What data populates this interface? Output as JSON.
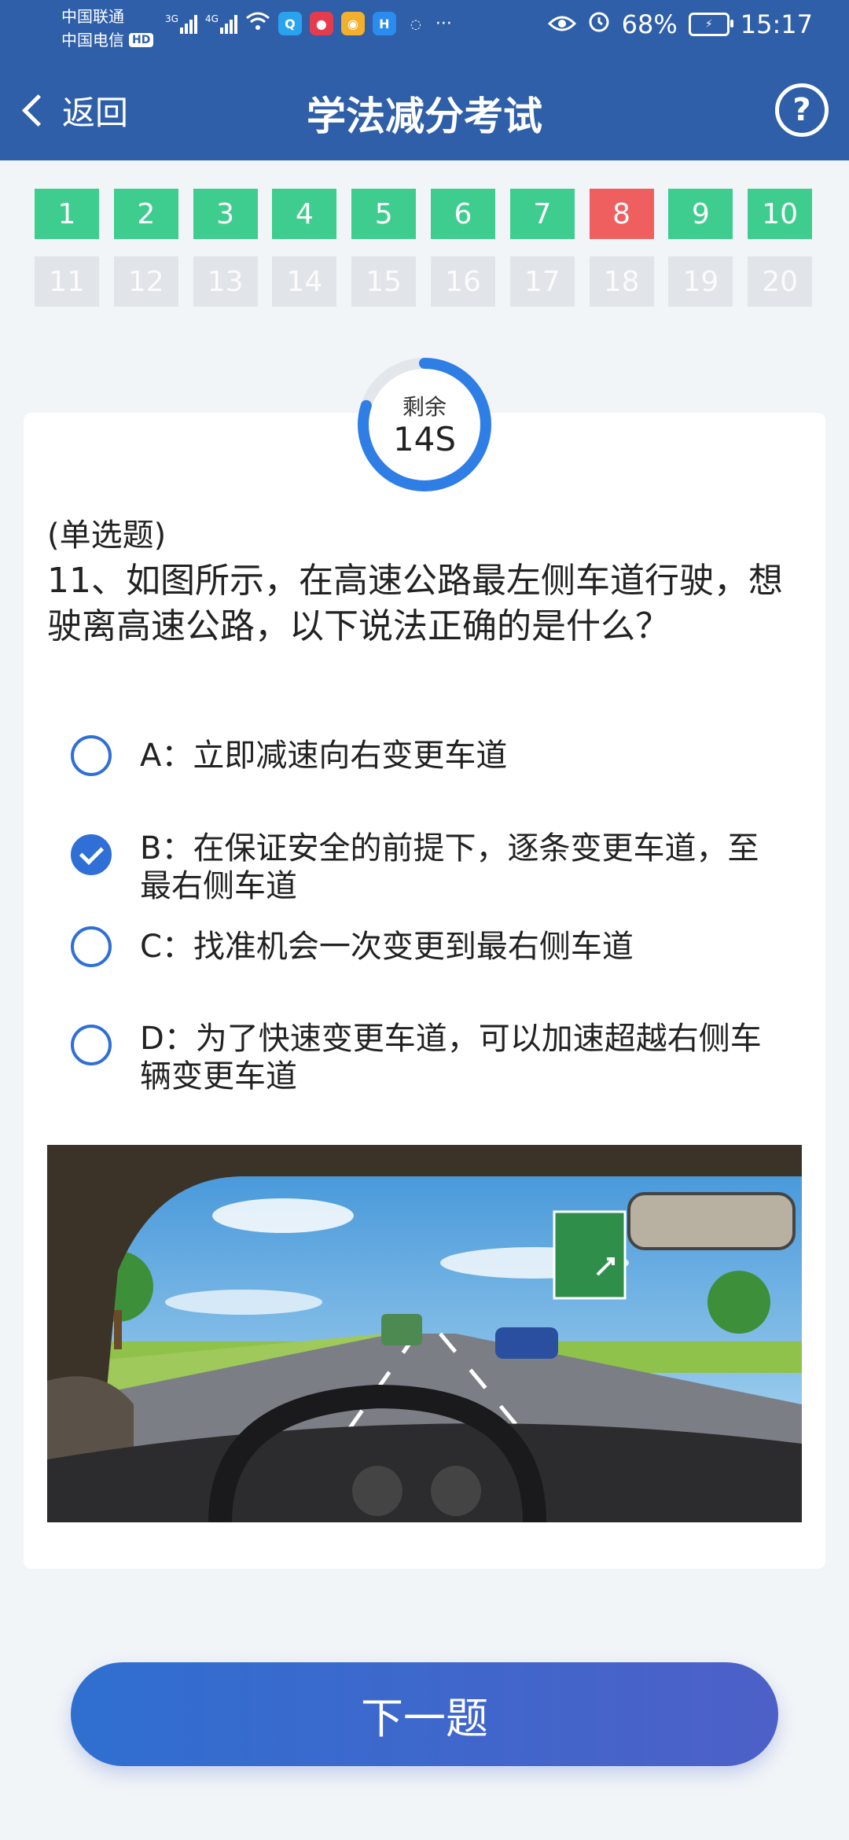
{
  "status_bar": {
    "carrier1": "中国联通",
    "carrier2": "中国电信",
    "hd": "HD",
    "net1": "3G",
    "net2": "4G",
    "battery": "68%",
    "time": "15:17"
  },
  "header": {
    "back_label": "返回",
    "title": "学法减分考试",
    "help_symbol": "?"
  },
  "questions": [
    {
      "n": "1",
      "state": "correct"
    },
    {
      "n": "2",
      "state": "correct"
    },
    {
      "n": "3",
      "state": "correct"
    },
    {
      "n": "4",
      "state": "correct"
    },
    {
      "n": "5",
      "state": "correct"
    },
    {
      "n": "6",
      "state": "correct"
    },
    {
      "n": "7",
      "state": "correct"
    },
    {
      "n": "8",
      "state": "wrong"
    },
    {
      "n": "9",
      "state": "correct"
    },
    {
      "n": "10",
      "state": "correct"
    },
    {
      "n": "11",
      "state": "pending"
    },
    {
      "n": "12",
      "state": "pending"
    },
    {
      "n": "13",
      "state": "pending"
    },
    {
      "n": "14",
      "state": "pending"
    },
    {
      "n": "15",
      "state": "pending"
    },
    {
      "n": "16",
      "state": "pending"
    },
    {
      "n": "17",
      "state": "pending"
    },
    {
      "n": "18",
      "state": "pending"
    },
    {
      "n": "19",
      "state": "pending"
    },
    {
      "n": "20",
      "state": "pending"
    }
  ],
  "timer": {
    "label": "剩余",
    "value": "14S",
    "remaining_fraction": 0.8
  },
  "question": {
    "type": "(单选题)",
    "text": "11、如图所示，在高速公路最左侧车道行驶，想驶离高速公路，以下说法正确的是什么？"
  },
  "options": [
    {
      "label": "A：立即减速向右变更车道",
      "selected": false
    },
    {
      "label": "B：在保证安全的前提下，逐条变更车道，至最右侧车道",
      "selected": true
    },
    {
      "label": "C：找准机会一次变更到最右侧车道",
      "selected": false
    },
    {
      "label": "D：为了快速变更车道，可以加速超越右侧车辆变更车道",
      "selected": false
    }
  ],
  "next_button": "下一题",
  "colors": {
    "header": "#2f5fa8",
    "correct": "#3ecd8f",
    "wrong": "#ef5f5f",
    "pending": "#e1e4e8",
    "accent": "#2f6fd6"
  }
}
